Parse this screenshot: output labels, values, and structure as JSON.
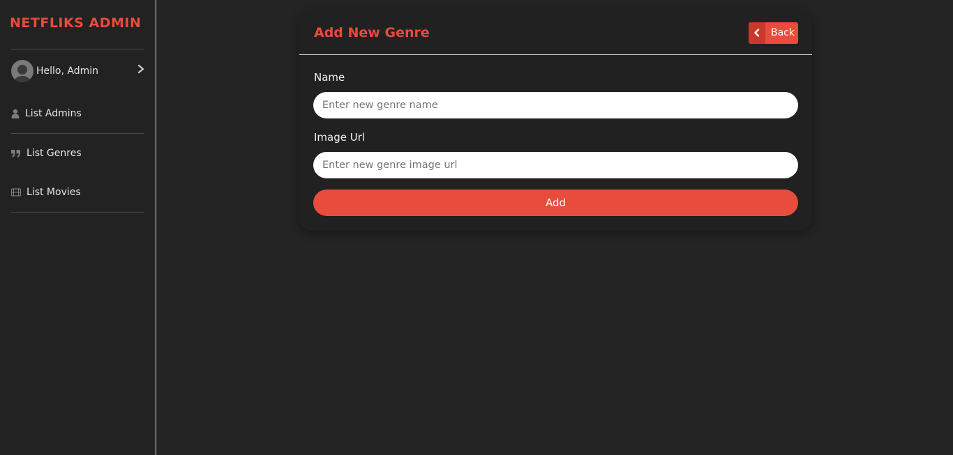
{
  "sidebar": {
    "brand": "NETFLIKS ADMIN",
    "user_greeting": "Hello, Admin",
    "items": [
      {
        "label": "List Admins",
        "icon": "user-icon"
      },
      {
        "label": "List Genres",
        "icon": "quote-icon"
      },
      {
        "label": "List Movies",
        "icon": "film-icon"
      }
    ]
  },
  "card": {
    "title": "Add New Genre",
    "back_label": "Back",
    "name_label": "Name",
    "name_placeholder": "Enter new genre name",
    "name_value": "",
    "image_label": "Image Url",
    "image_placeholder": "Enter new genre image url",
    "image_value": "",
    "submit_label": "Add"
  },
  "colors": {
    "accent": "#e74c3c",
    "background": "#242424",
    "sidebar": "#222222"
  }
}
